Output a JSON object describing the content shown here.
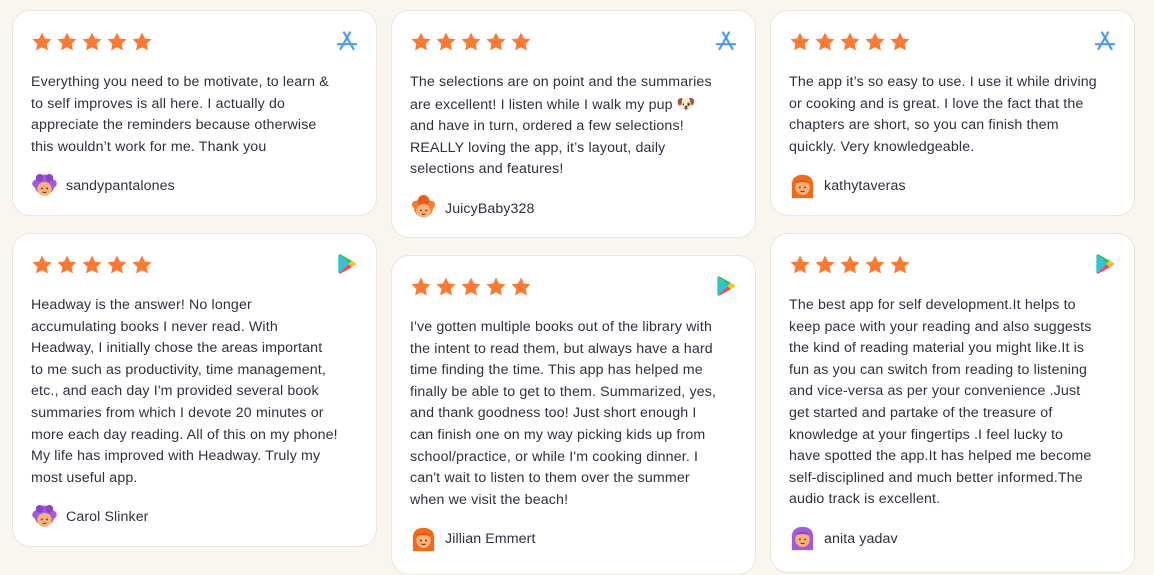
{
  "colors": {
    "star": "#fb7a33",
    "page_bg": "#f9f5ef",
    "card_bg": "#ffffff",
    "app_store_blue": "#4a9bf0",
    "avatar_orange": "#f77b2c",
    "avatar_purple": "#a35bd8"
  },
  "reviews": [
    {
      "rating": 5,
      "store_icon": "app-store-icon",
      "text": "Everything you need to be motivate, to learn &\nto self improves is all here. I actually do\nappreciate the reminders because otherwise\nthis wouldn’t work for me. Thank you",
      "author": "sandypantalones",
      "avatar_icon": "avatar-purple-hair-icon"
    },
    {
      "rating": 5,
      "store_icon": "google-play-icon",
      "text": "Headway is the answer! No longer\naccumulating books I never read. With\nHeadway, I initially chose the areas important\nto me such as productivity, time management,\netc., and each day I'm provided several book\nsummaries from which I devote 20 minutes or\nmore each day reading. All of this on my phone!\nMy life has improved with Headway. Truly my\nmost useful app.",
      "author": "Carol Slinker",
      "avatar_icon": "avatar-purple-hair-icon"
    },
    {
      "rating": 5,
      "store_icon": "app-store-icon",
      "text_before_emoji": "The selections are on point and the summaries\nare excellent! I listen while I walk my pup ",
      "emoji": "🐶",
      "text_after_emoji": "\nand have in turn, ordered a few selections!\nREALLY loving the app, it’s layout, daily\nselections and features!",
      "author": "JuicyBaby328",
      "avatar_icon": "avatar-orange-hair-icon"
    },
    {
      "rating": 5,
      "store_icon": "google-play-icon",
      "text": "I've gotten multiple books out of the library with\nthe intent to read them, but always have a hard\ntime finding the time. This app has helped me\nfinally be able to get to them. Summarized, yes,\nand thank goodness too! Just short enough I\ncan finish one on my way picking kids up from\nschool/practice, or while I'm cooking dinner. I\ncan't wait to listen to them over the summer\nwhen we visit the beach!",
      "author": "Jillian Emmert",
      "avatar_icon": "avatar-orange-long-hair-icon"
    },
    {
      "rating": 5,
      "store_icon": "app-store-icon",
      "text": "The app it’s so easy to use. I use it while driving\nor cooking and is great. I love the fact that the\nchapters are short, so you can finish them\nquickly. Very knowledgeable.",
      "author": "kathytaveras",
      "avatar_icon": "avatar-orange-long-hair-icon"
    },
    {
      "rating": 5,
      "store_icon": "google-play-icon",
      "text": "The best app for self development.It helps to\nkeep pace with your reading and also suggests\nthe kind of reading material you might like.It is\nfun as you can switch from reading to listening\nand vice-versa as per your convenience .Just\nget started and partake of the treasure of\nknowledge at your fingertips .I feel lucky to\nhave spotted the app.It has helped me become\nself-disciplined and much better informed.The\naudio track is excellent.",
      "author": "anita yadav",
      "avatar_icon": "avatar-purple-long-hair-icon"
    }
  ]
}
